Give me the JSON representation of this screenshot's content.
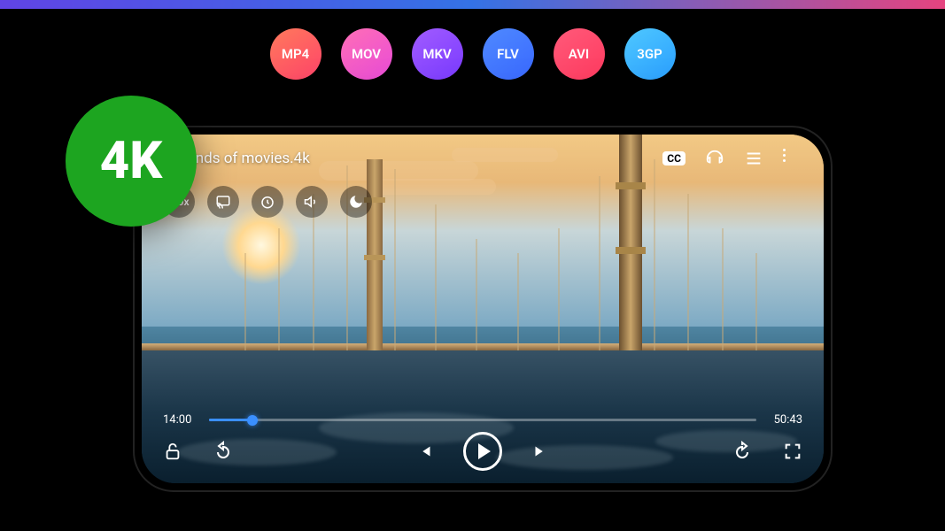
{
  "top_gradient_colors": [
    "#6b4bff",
    "#3a7fff",
    "#ff4b8d"
  ],
  "formats": [
    {
      "label": "MP4",
      "color_class": "pill-mp4"
    },
    {
      "label": "MOV",
      "color_class": "pill-mov"
    },
    {
      "label": "MKV",
      "color_class": "pill-mkv"
    },
    {
      "label": "FLV",
      "color_class": "pill-flv"
    },
    {
      "label": "AVI",
      "color_class": "pill-avi"
    },
    {
      "label": "3GP",
      "color_class": "pill-3gp"
    }
  ],
  "badge_4k": "4K",
  "player": {
    "title": "Legends of movies.4k",
    "speed_label": "1.0x",
    "cc_label": "CC",
    "elapsed": "14:00",
    "duration": "50:43",
    "progress_percent": 8
  }
}
